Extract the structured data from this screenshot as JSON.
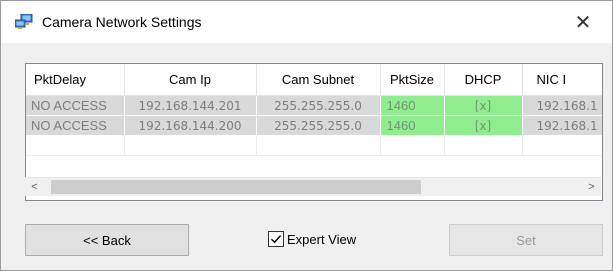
{
  "window": {
    "title": "Camera Network Settings",
    "close_glyph": "✕"
  },
  "grid": {
    "columns": [
      "PktDelay",
      "Cam Ip",
      "Cam Subnet",
      "PktSize",
      "DHCP",
      "NIC I"
    ],
    "rows": [
      [
        "NO ACCESS",
        "192.168.144.201",
        "255.255.255.0",
        "1460",
        "[x]",
        "192.168.1"
      ],
      [
        "NO ACCESS",
        "192.168.144.200",
        "255.255.255.0",
        "1460",
        "[x]",
        "192.168.1"
      ]
    ],
    "highlight_color": "#90ee90",
    "row_color": "#d9d9d9"
  },
  "scrollbar": {
    "left_glyph": "<",
    "right_glyph": ">"
  },
  "footer": {
    "back_label": "<< Back",
    "expert_view_label": "Expert View",
    "expert_view_checked": true,
    "set_label": "Set"
  }
}
